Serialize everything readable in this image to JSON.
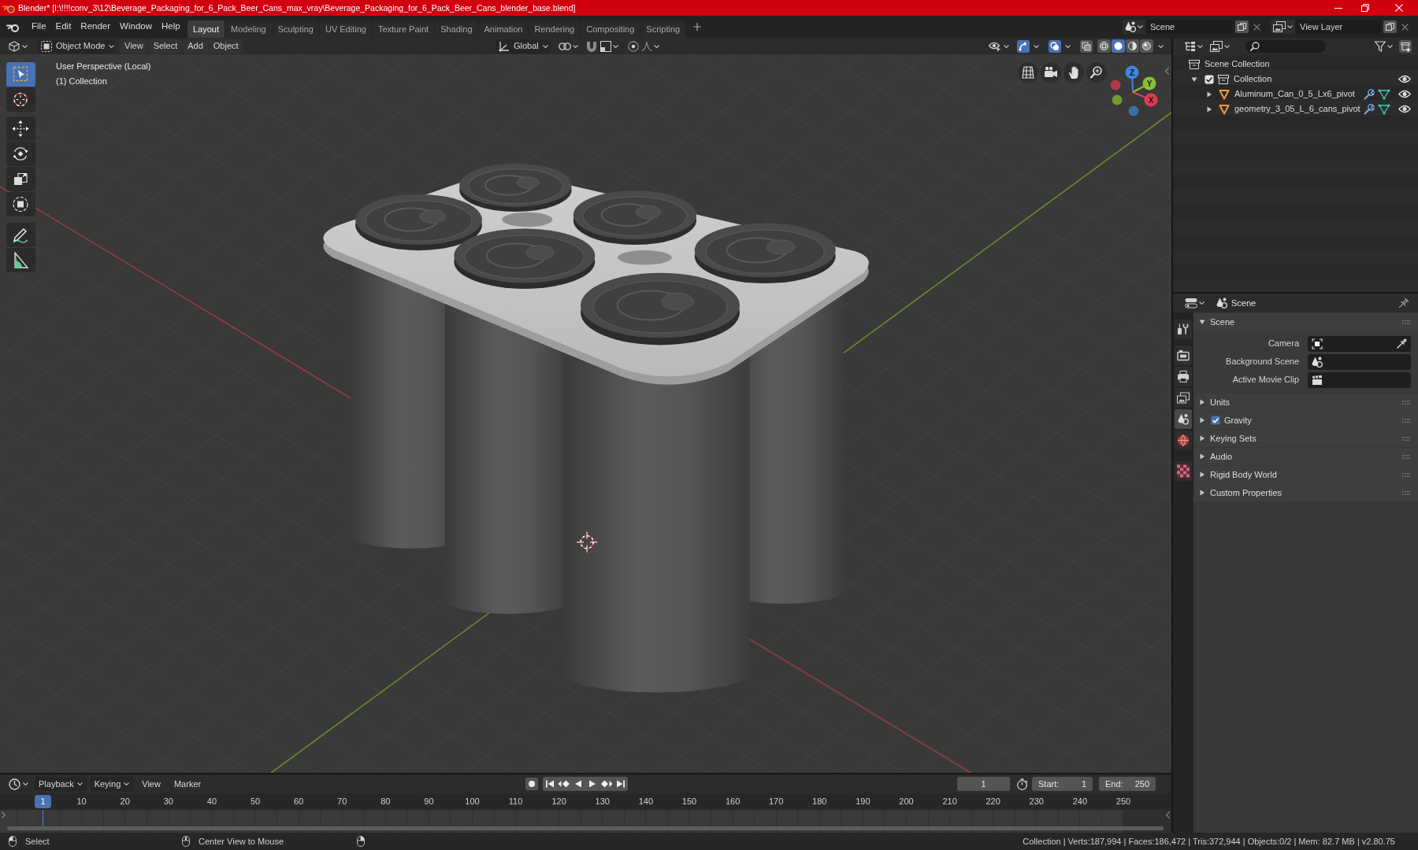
{
  "window": {
    "title": "Blender* [I:\\!!!!conv_3\\12\\Beverage_Packaging_for_6_Pack_Beer_Cans_max_vray\\Beverage_Packaging_for_6_Pack_Beer_Cans_blender_base.blend]"
  },
  "top_bar": {
    "menus": [
      "File",
      "Edit",
      "Render",
      "Window",
      "Help"
    ],
    "workspaces": [
      {
        "label": "Layout",
        "selected": true
      },
      {
        "label": "Modeling",
        "selected": false
      },
      {
        "label": "Sculpting",
        "selected": false
      },
      {
        "label": "UV Editing",
        "selected": false
      },
      {
        "label": "Texture Paint",
        "selected": false
      },
      {
        "label": "Shading",
        "selected": false
      },
      {
        "label": "Animation",
        "selected": false
      },
      {
        "label": "Rendering",
        "selected": false
      },
      {
        "label": "Compositing",
        "selected": false
      },
      {
        "label": "Scripting",
        "selected": false
      }
    ],
    "scene": "Scene",
    "view_layer": "View Layer"
  },
  "viewport": {
    "header": {
      "mode": "Object Mode",
      "menus": [
        "View",
        "Select",
        "Add",
        "Object"
      ],
      "orientation": "Global",
      "gizmos": {
        "on": true
      },
      "overlays": {
        "on": true
      },
      "shading": [
        {
          "selected": false
        },
        {
          "selected": true
        },
        {
          "selected": false
        },
        {
          "selected": false
        }
      ]
    },
    "view_name": "User Perspective (Local)",
    "collection_label": "(1) Collection",
    "tools": [
      {
        "selected": true
      },
      {
        "selected": false
      },
      {
        "selected": false
      },
      {
        "selected": false
      },
      {
        "selected": false
      },
      {
        "selected": false
      },
      {
        "selected": false
      },
      {
        "selected": false
      }
    ],
    "axes": [
      {
        "label": "X",
        "color": "#e23b50"
      },
      {
        "label": "Y",
        "color": "#87c22e"
      },
      {
        "label": "Z",
        "color": "#3d84d9"
      }
    ]
  },
  "outliner": {
    "items": [
      {
        "kind": "scene_collection",
        "label": "Scene Collection",
        "children": [
          {
            "kind": "collection",
            "label": "Collection",
            "expanded": true,
            "checked": true,
            "visible": true,
            "children": [
              {
                "kind": "mesh",
                "label": "Aluminum_Can_0_5_Lx6_pivot",
                "expanded": false,
                "visible": true
              },
              {
                "kind": "mesh",
                "label": "geometry_3_05_L_6_cans_pivot",
                "expanded": false,
                "visible": true
              }
            ]
          }
        ]
      }
    ]
  },
  "properties": {
    "context": "Scene",
    "tabs": [
      {
        "selected": false
      },
      {
        "selected": false
      },
      {
        "selected": false
      },
      {
        "selected": false
      },
      {
        "selected": true
      },
      {
        "selected": false
      },
      {
        "selected": false
      }
    ],
    "panels": [
      {
        "label": "Scene",
        "expanded": true,
        "fields": [
          {
            "label": "Camera"
          },
          {
            "label": "Background Scene"
          },
          {
            "label": "Active Movie Clip"
          }
        ]
      },
      {
        "label": "Units",
        "expanded": false
      },
      {
        "label": "Gravity",
        "expanded": false,
        "checked": true
      },
      {
        "label": "Keying Sets",
        "expanded": false
      },
      {
        "label": "Audio",
        "expanded": false
      },
      {
        "label": "Rigid Body World",
        "expanded": false
      },
      {
        "label": "Custom Properties",
        "expanded": false
      }
    ]
  },
  "timeline": {
    "menus": [
      {
        "label": "Playback",
        "kind": "dropdown"
      },
      {
        "label": "Keying",
        "kind": "dropdown"
      },
      {
        "label": "View",
        "kind": "menu"
      },
      {
        "label": "Marker",
        "kind": "menu"
      }
    ],
    "current_frame": "1",
    "start_label": "Start:",
    "start": "1",
    "end_label": "End:",
    "end": "250",
    "playhead": "1",
    "frame_labels": [
      "10",
      "20",
      "30",
      "40",
      "50",
      "60",
      "70",
      "80",
      "90",
      "100",
      "110",
      "120",
      "130",
      "140",
      "150",
      "160",
      "170",
      "180",
      "190",
      "200",
      "210",
      "220",
      "230",
      "240",
      "250"
    ]
  },
  "status_bar": {
    "hints": [
      "Select",
      "Center View to Mouse"
    ],
    "stats": "Collection | Verts:187,994 | Faces:186,472 | Tris:372,944 | Objects:0/2 | Mem: 82.7 MB | v2.80.75"
  }
}
